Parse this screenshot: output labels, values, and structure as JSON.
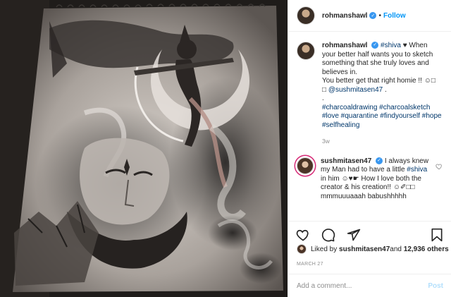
{
  "post": {
    "author": "rohmanshawl",
    "follow_separator": "•",
    "follow_label": "Follow",
    "caption": {
      "username": "rohmanshawl",
      "hashtag_shiva": "#shiva",
      "line1": " ♥ When your better half wants you to sketch something that she truly loves and believes in.",
      "line2": "You better get that right homie !! ☺□",
      "line3_prefix": "□ ",
      "mention": "@sushmitasen47",
      "line3_suffix": " .",
      "dot_line": ".",
      "hashtags": "#charcoaldrawing #charcoalsketch #love #quarantine #findyourself #hope #selfhealing",
      "time": "3w"
    },
    "comment": {
      "username": "sushmitasen47",
      "text_before": " I always knew my Man had to have a little ",
      "hashtag": "#shiva",
      "text_after": " in him ☺♥☛ How I love both the creator & his creation!! ☺✐□□ mmmuuuaaah babushhhhh"
    },
    "likes": {
      "prefix": "Liked by ",
      "user": "sushmitasen47",
      "middle": " and ",
      "count": "12,936 others"
    },
    "date": "MARCH 27",
    "add_comment_placeholder": "Add a comment...",
    "post_label": "Post"
  },
  "icons": {
    "verified": "verified-badge-icon",
    "like": "heart-icon",
    "comment": "comment-icon",
    "share": "share-icon",
    "save": "bookmark-icon"
  },
  "colors": {
    "link_blue": "#0095f6",
    "hashtag_navy": "#00376b",
    "muted_gray": "#8e8e8e",
    "post_disabled": "#b2dffc"
  }
}
